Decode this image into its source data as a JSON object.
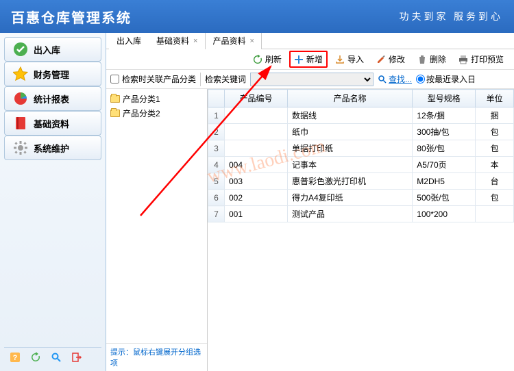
{
  "header": {
    "title": "百惠仓库管理系统",
    "slogan": "功夫到家 服务到心"
  },
  "sidebar": {
    "items": [
      {
        "label": "出入库",
        "icon": "check-circle",
        "color": "#4caf50"
      },
      {
        "label": "财务管理",
        "icon": "star",
        "color": "#ffc107"
      },
      {
        "label": "统计报表",
        "icon": "pie",
        "color": "#2196f3"
      },
      {
        "label": "基础资料",
        "icon": "book",
        "color": "#e53935"
      },
      {
        "label": "系统维护",
        "icon": "gear",
        "color": "#9e9e9e"
      }
    ],
    "bottom_icons": [
      "help-icon",
      "refresh-icon",
      "search-icon",
      "exit-icon"
    ]
  },
  "tabs": [
    {
      "label": "出入库",
      "active": false
    },
    {
      "label": "基础资料",
      "active": false,
      "closable": true
    },
    {
      "label": "产品资料",
      "active": true,
      "closable": true
    }
  ],
  "toolbar": {
    "refresh": "刷新",
    "add": "新增",
    "import": "导入",
    "edit": "修改",
    "delete": "删除",
    "print": "打印预览"
  },
  "searchbar": {
    "cascade_label": "检索时关联产品分类",
    "keyword_label": "检索关键词",
    "search_link": "查找...",
    "recent_label": "按最近录入日"
  },
  "tree": {
    "nodes": [
      "产品分类1",
      "产品分类2"
    ],
    "hint_prefix": "提示：",
    "hint": "鼠标右键展开分组选项"
  },
  "table": {
    "columns": [
      "产品编号",
      "产品名称",
      "型号规格",
      "单位"
    ],
    "rows": [
      {
        "num": "1",
        "code": "",
        "name": "数据线",
        "spec": "12条/捆",
        "unit": "捆"
      },
      {
        "num": "2",
        "code": "",
        "name": "纸巾",
        "spec": "300抽/包",
        "unit": "包"
      },
      {
        "num": "3",
        "code": "",
        "name": "单据打印纸",
        "spec": "80张/包",
        "unit": "包"
      },
      {
        "num": "4",
        "code": "004",
        "name": "记事本",
        "spec": "A5/70页",
        "unit": "本"
      },
      {
        "num": "5",
        "code": "003",
        "name": "惠普彩色激光打印机",
        "spec": "M2DH5",
        "unit": "台"
      },
      {
        "num": "6",
        "code": "002",
        "name": "得力A4复印纸",
        "spec": "500张/包",
        "unit": "包"
      },
      {
        "num": "7",
        "code": "001",
        "name": "测试产品",
        "spec": "100*200",
        "unit": ""
      }
    ]
  },
  "watermark": "www.laodi.com"
}
